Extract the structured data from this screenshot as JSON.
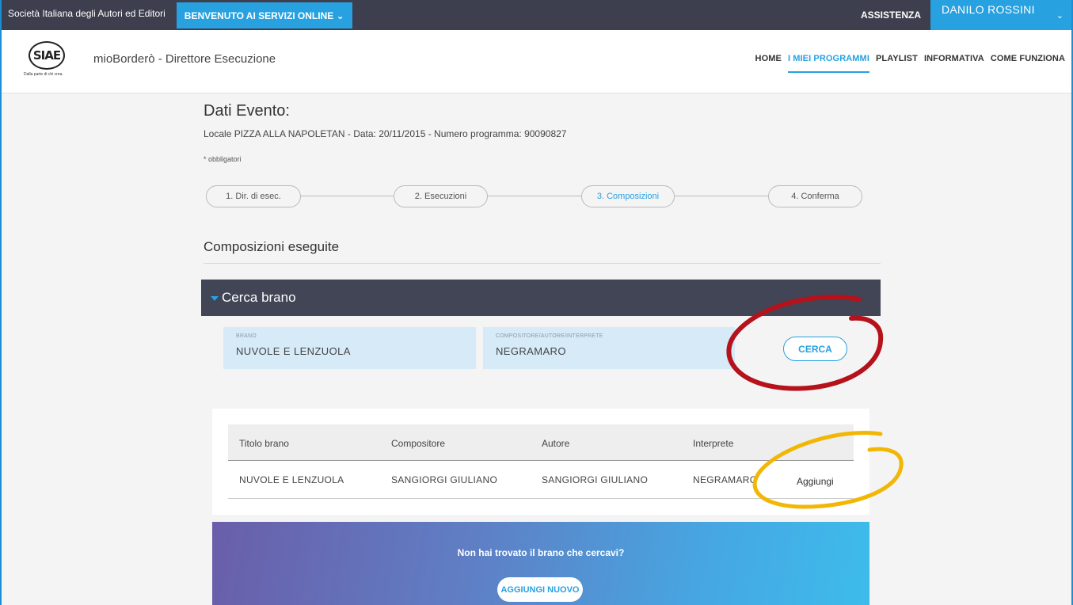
{
  "topbar": {
    "org_name": "Società Italiana degli Autori ed Editori",
    "welcome_menu": "BENVENUTO AI SERVIZI ONLINE ⌄",
    "assistance": "ASSISTENZA",
    "user_name": "DANILO ROSSINI"
  },
  "header": {
    "logo_text": "SIAE",
    "logo_tagline": "Dalla parte di chi crea.",
    "app_title": "mioBorderò - Direttore Esecuzione",
    "nav": [
      "HOME",
      "I MIEI PROGRAMMI",
      "PLAYLIST",
      "INFORMATIVA",
      "COME FUNZIONA"
    ],
    "active_nav": "I MIEI PROGRAMMI"
  },
  "event": {
    "title": "Dati Evento:",
    "info": "Locale PIZZA ALLA NAPOLETAN - Data: 20/11/2015 - Numero programma: 90090827",
    "required_note": "* obbligatori"
  },
  "steps": [
    {
      "label": "1. Dir. di esec.",
      "active": false
    },
    {
      "label": "2. Esecuzioni",
      "active": false
    },
    {
      "label": "3. Composizioni",
      "active": true
    },
    {
      "label": "4. Conferma",
      "active": false
    }
  ],
  "section": {
    "title": "Composizioni eseguite",
    "accordion_title": "Cerca brano"
  },
  "search": {
    "brano_label": "BRANO",
    "brano_value": "NUVOLE E LENZUOLA",
    "artist_label": "COMPOSITORE/AUTORE/INTERPRETE",
    "artist_value": "NEGRAMARO",
    "button_label": "CERCA"
  },
  "results": {
    "columns": [
      "Titolo brano",
      "Compositore",
      "Autore",
      "Interprete"
    ],
    "rows": [
      {
        "title": "NUVOLE E LENZUOLA",
        "composer": "SANGIORGI GIULIANO",
        "author": "SANGIORGI GIULIANO",
        "performer": "NEGRAMARO",
        "action": "Aggiungi"
      }
    ]
  },
  "promo": {
    "question": "Non hai trovato il brano che cercavi?",
    "button_label": "AGGIUNGI NUOVO"
  },
  "colors": {
    "accent": "#27a1e0",
    "dark_bar": "#3d3f4f",
    "annotation_red": "#b5121b",
    "annotation_yellow": "#f2b705"
  }
}
